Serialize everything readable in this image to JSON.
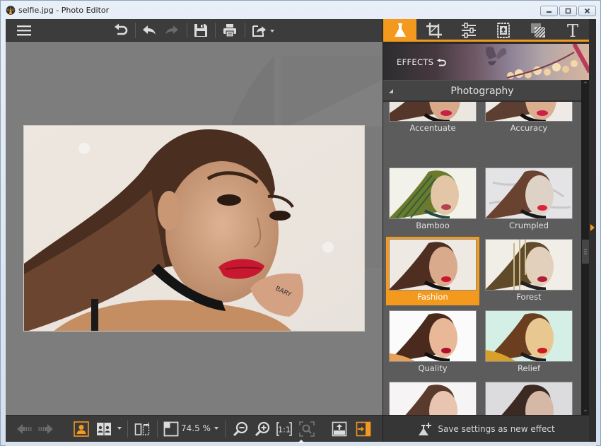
{
  "window": {
    "title": "selfie.jpg - Photo Editor",
    "controls": [
      "minimize",
      "maximize",
      "close"
    ]
  },
  "toolbar": {
    "items": [
      {
        "name": "menu",
        "icon": "hamburger-icon"
      },
      {
        "name": "revert",
        "icon": "revert-icon"
      },
      {
        "name": "undo",
        "icon": "undo-icon"
      },
      {
        "name": "redo",
        "icon": "redo-icon",
        "disabled": true
      },
      {
        "name": "save",
        "icon": "save-icon"
      },
      {
        "name": "print",
        "icon": "print-icon"
      },
      {
        "name": "share",
        "icon": "share-icon",
        "has_dropdown": true
      }
    ]
  },
  "right_tabs": [
    {
      "name": "effects",
      "icon": "flask-icon",
      "active": true
    },
    {
      "name": "crop",
      "icon": "crop-icon"
    },
    {
      "name": "adjust",
      "icon": "sliders-icon"
    },
    {
      "name": "frames",
      "icon": "frame-icon"
    },
    {
      "name": "layers",
      "icon": "layers-icon"
    },
    {
      "name": "text",
      "icon": "text-icon"
    }
  ],
  "effects_panel": {
    "banner_label": "EFFECTS",
    "category": "Photography",
    "effects": [
      {
        "label": "Accentuate",
        "selected": false
      },
      {
        "label": "Accuracy",
        "selected": false
      },
      {
        "label": "Bamboo",
        "selected": false
      },
      {
        "label": "Crumpled",
        "selected": false
      },
      {
        "label": "Fashion",
        "selected": true
      },
      {
        "label": "Forest",
        "selected": false
      },
      {
        "label": "Quality",
        "selected": false
      },
      {
        "label": "Relief",
        "selected": false
      },
      {
        "label": "",
        "selected": false
      },
      {
        "label": "",
        "selected": false
      }
    ],
    "save_label": "Save settings as new effect"
  },
  "bottom_bar": {
    "zoom_value": "74.5 %",
    "items": [
      {
        "name": "previous-image",
        "icon": "arrow-left-icon",
        "disabled": true
      },
      {
        "name": "next-image",
        "icon": "arrow-right-icon",
        "disabled": true
      },
      {
        "name": "single-view",
        "icon": "single-person-icon",
        "active": true
      },
      {
        "name": "compare-view",
        "icon": "compare-icon",
        "has_dropdown": true
      },
      {
        "name": "split-view",
        "icon": "split-view-icon"
      },
      {
        "name": "fit-window",
        "icon": "fit-icon"
      },
      {
        "name": "zoom-out",
        "icon": "zoom-out-icon"
      },
      {
        "name": "zoom-in",
        "icon": "zoom-in-icon"
      },
      {
        "name": "actual-size",
        "icon": "one-to-one-icon"
      },
      {
        "name": "zoom-to-selection",
        "icon": "zoom-selection-icon",
        "disabled": true
      },
      {
        "name": "export",
        "icon": "export-icon"
      },
      {
        "name": "toggle-panel",
        "icon": "panel-toggle-icon",
        "active": true
      }
    ]
  },
  "colors": {
    "accent": "#f39a1e",
    "toolbar_bg": "#3c3c3c",
    "canvas_bg": "#7d7d7d",
    "panel_bg": "#5c5c5c"
  }
}
